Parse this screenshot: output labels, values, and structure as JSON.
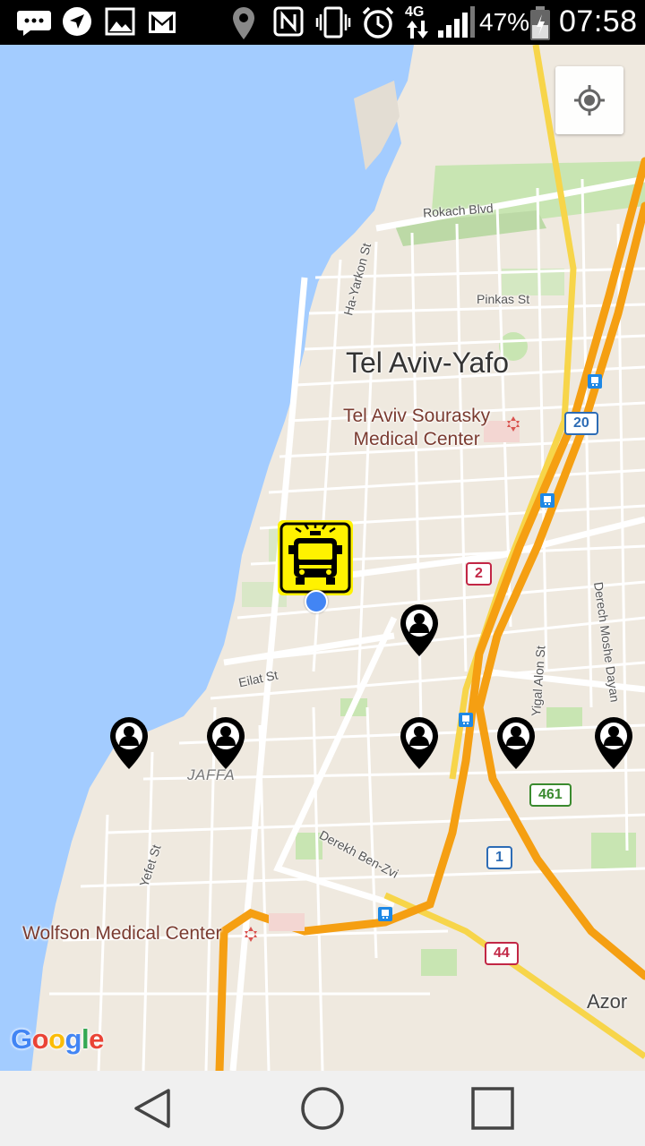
{
  "status_bar": {
    "icons": [
      "chat-icon",
      "navigation-arrow-icon",
      "image-icon",
      "gmail-icon",
      "location-pin-icon",
      "nfc-icon",
      "vibrate-icon",
      "alarm-icon",
      "4g-data-icon",
      "signal-icon",
      "battery-icon"
    ],
    "network_label": "4G",
    "battery_percent": "47%",
    "time": "07:58"
  },
  "map": {
    "city_label": "Tel Aviv-Yafo",
    "hospital_1": "Tel Aviv Sourasky\nMedical Center",
    "hospital_2": "Wolfson Medical Center",
    "district_label": "JAFFA",
    "town_label": "Azor",
    "streets": {
      "rokach": "Rokach Blvd",
      "hayarkon": "Ha-Yarkon St",
      "pinkas": "Pinkas St",
      "eilat": "Eilat St",
      "yigal_alon": "Yigal Alon St",
      "moshe_dayan": "Derech Moshe Dayan",
      "yefet": "Yefet St",
      "ben_zvi": "Derekh Ben-Zvi"
    },
    "road_shields": {
      "r20": "20",
      "r2": "2",
      "r461": "461",
      "r1": "1",
      "r44": "44"
    },
    "attribution": {
      "letters": [
        "G",
        "o",
        "o",
        "g",
        "l",
        "e"
      ],
      "colors": [
        "#4285F4",
        "#EA4335",
        "#FBBC05",
        "#4285F4",
        "#34A853",
        "#EA4335"
      ]
    },
    "colors": {
      "water": "#a3ccff",
      "land": "#efe9df",
      "highway": "#f59f12",
      "arterial": "#f7d54a",
      "park": "#c8e5b2",
      "bus_marker": "#fff200",
      "location_dot": "#4285f4"
    }
  },
  "nav_bar": {
    "icons": [
      "back-icon",
      "home-icon",
      "recents-icon"
    ]
  }
}
